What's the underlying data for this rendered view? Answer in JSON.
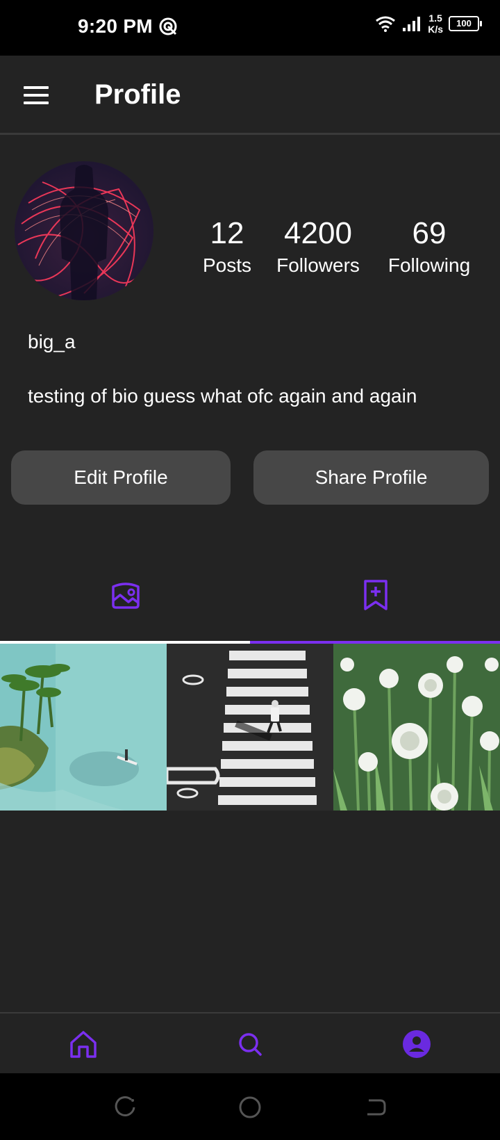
{
  "status_bar": {
    "time": "9:20 PM",
    "net_speed_value": "1.5",
    "net_speed_unit": "K/s",
    "battery": "100"
  },
  "header": {
    "title": "Profile",
    "menu_icon": "hamburger-menu-icon"
  },
  "profile": {
    "username": "big_a",
    "bio": "testing of bio guess what ofc again and again",
    "stats": [
      {
        "value": "12",
        "label": "Posts"
      },
      {
        "value": "4200",
        "label": "Followers"
      },
      {
        "value": "69",
        "label": "Following"
      }
    ]
  },
  "actions": {
    "edit_label": "Edit Profile",
    "share_label": "Share Profile"
  },
  "tabs": [
    {
      "icon": "gallery-icon",
      "active": false
    },
    {
      "icon": "bookmark-add-icon",
      "active": true
    }
  ],
  "posts": [
    {
      "subject": "tropical-coast-paddleboard"
    },
    {
      "subject": "crosswalk-pedestrian-bw"
    },
    {
      "subject": "white-allium-flowers"
    }
  ],
  "bottom_nav": [
    {
      "icon": "home-icon"
    },
    {
      "icon": "search-icon"
    },
    {
      "icon": "profile-avatar-icon"
    }
  ],
  "colors": {
    "background": "#232323",
    "accent": "#7b2ff0",
    "button": "#474747"
  }
}
